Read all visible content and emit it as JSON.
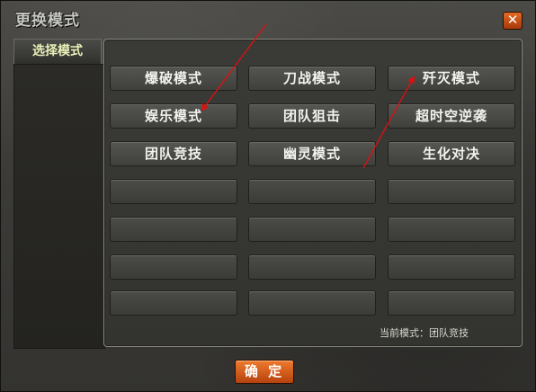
{
  "window": {
    "title": "更换模式",
    "close_label": "✕"
  },
  "tabs": [
    {
      "label": "选择模式",
      "active": true
    }
  ],
  "modes": {
    "row1": [
      "爆破模式",
      "刀战模式",
      "歼灭模式"
    ],
    "row2": [
      "娱乐模式",
      "团队狙击",
      "超时空逆袭"
    ],
    "row3": [
      "团队竞技",
      "幽灵模式",
      "生化对决"
    ],
    "empty_rows": 4
  },
  "status": {
    "current_mode_text": "当前模式：团队竞技"
  },
  "footer": {
    "confirm_label": "确 定"
  },
  "colors": {
    "accent_orange": "#d4571a",
    "annotation_red": "#e01010",
    "tab_text": "#e9f0b6"
  }
}
